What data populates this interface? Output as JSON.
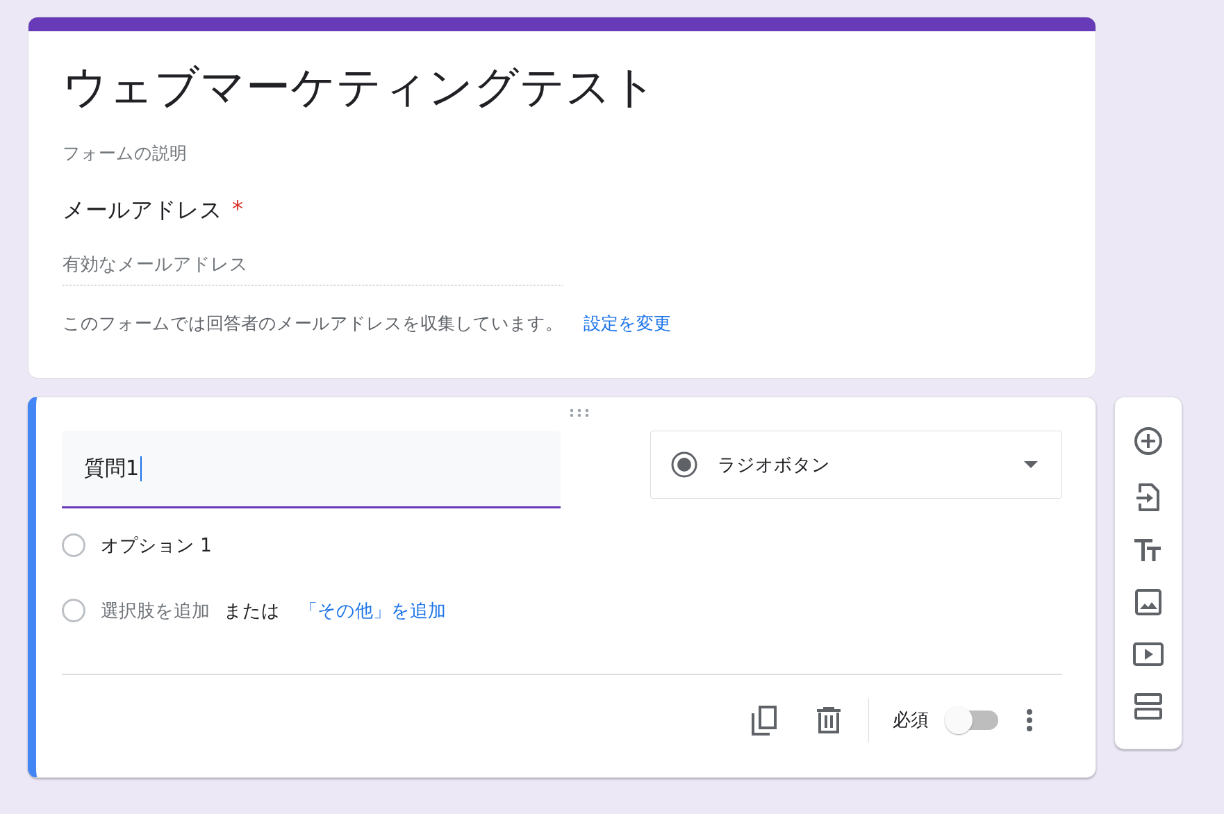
{
  "header": {
    "title": "ウェブマーケティングテスト",
    "description_placeholder": "フォームの説明",
    "email_label": "メールアドレス",
    "required_mark": "*",
    "email_placeholder": "有効なメールアドレス",
    "note": "このフォームでは回答者のメールアドレスを収集しています。",
    "note_link": "設定を変更"
  },
  "question": {
    "title": "質問1",
    "focused": true,
    "type": "ラジオボタン",
    "options": [
      {
        "kind": "option",
        "label": "オプション 1"
      },
      {
        "kind": "add",
        "label": "選択肢を追加",
        "or": "または",
        "link": "「その他」を追加"
      }
    ],
    "required_label": "必須",
    "required": false
  }
}
